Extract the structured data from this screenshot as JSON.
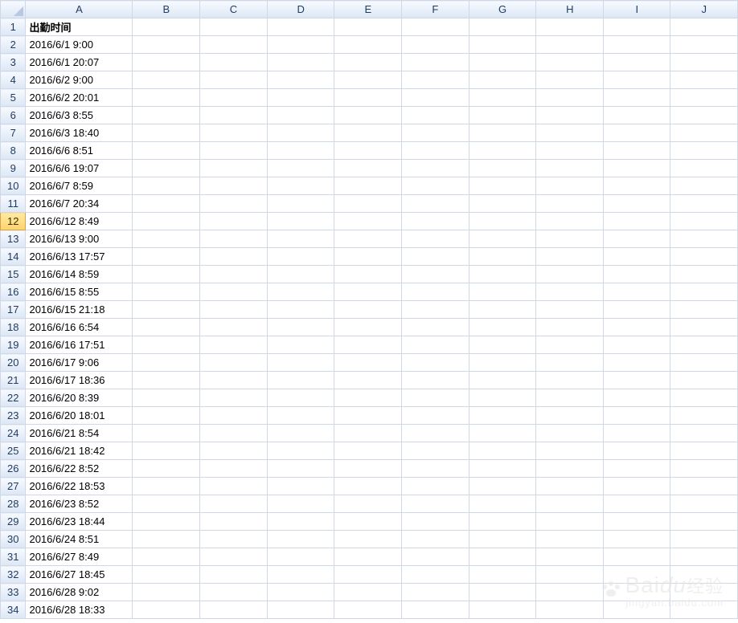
{
  "columns": [
    "A",
    "B",
    "C",
    "D",
    "E",
    "F",
    "G",
    "H",
    "I",
    "J"
  ],
  "row_count": 34,
  "selected_row": 12,
  "header_cell": "出勤时间",
  "data_a": [
    "2016/6/1 9:00",
    "2016/6/1 20:07",
    "2016/6/2 9:00",
    "2016/6/2 20:01",
    "2016/6/3 8:55",
    "2016/6/3 18:40",
    "2016/6/6 8:51",
    "2016/6/6 19:07",
    "2016/6/7 8:59",
    "2016/6/7 20:34",
    "2016/6/12 8:49",
    "2016/6/13 9:00",
    "2016/6/13 17:57",
    "2016/6/14 8:59",
    "2016/6/15 8:55",
    "2016/6/15 21:18",
    "2016/6/16 6:54",
    "2016/6/16 17:51",
    "2016/6/17 9:06",
    "2016/6/17 18:36",
    "2016/6/20 8:39",
    "2016/6/20 18:01",
    "2016/6/21 8:54",
    "2016/6/21 18:42",
    "2016/6/22 8:52",
    "2016/6/22 18:53",
    "2016/6/23 8:52",
    "2016/6/23 18:44",
    "2016/6/24 8:51",
    "2016/6/27 8:49",
    "2016/6/27 18:45",
    "2016/6/28 9:02",
    "2016/6/28 18:33"
  ],
  "watermark": {
    "main_en": "Bai",
    "main_du": "du",
    "main_cn": "经验",
    "sub": "jingyan.baidu.com"
  },
  "chart_data": {
    "type": "table",
    "title": "出勤时间",
    "columns": [
      "出勤时间"
    ],
    "rows": [
      [
        "2016/6/1 9:00"
      ],
      [
        "2016/6/1 20:07"
      ],
      [
        "2016/6/2 9:00"
      ],
      [
        "2016/6/2 20:01"
      ],
      [
        "2016/6/3 8:55"
      ],
      [
        "2016/6/3 18:40"
      ],
      [
        "2016/6/6 8:51"
      ],
      [
        "2016/6/6 19:07"
      ],
      [
        "2016/6/7 8:59"
      ],
      [
        "2016/6/7 20:34"
      ],
      [
        "2016/6/12 8:49"
      ],
      [
        "2016/6/13 9:00"
      ],
      [
        "2016/6/13 17:57"
      ],
      [
        "2016/6/14 8:59"
      ],
      [
        "2016/6/15 8:55"
      ],
      [
        "2016/6/15 21:18"
      ],
      [
        "2016/6/16 6:54"
      ],
      [
        "2016/6/16 17:51"
      ],
      [
        "2016/6/17 9:06"
      ],
      [
        "2016/6/17 18:36"
      ],
      [
        "2016/6/20 8:39"
      ],
      [
        "2016/6/20 18:01"
      ],
      [
        "2016/6/21 8:54"
      ],
      [
        "2016/6/21 18:42"
      ],
      [
        "2016/6/22 8:52"
      ],
      [
        "2016/6/22 18:53"
      ],
      [
        "2016/6/23 8:52"
      ],
      [
        "2016/6/23 18:44"
      ],
      [
        "2016/6/24 8:51"
      ],
      [
        "2016/6/27 8:49"
      ],
      [
        "2016/6/27 18:45"
      ],
      [
        "2016/6/28 9:02"
      ],
      [
        "2016/6/28 18:33"
      ]
    ]
  }
}
